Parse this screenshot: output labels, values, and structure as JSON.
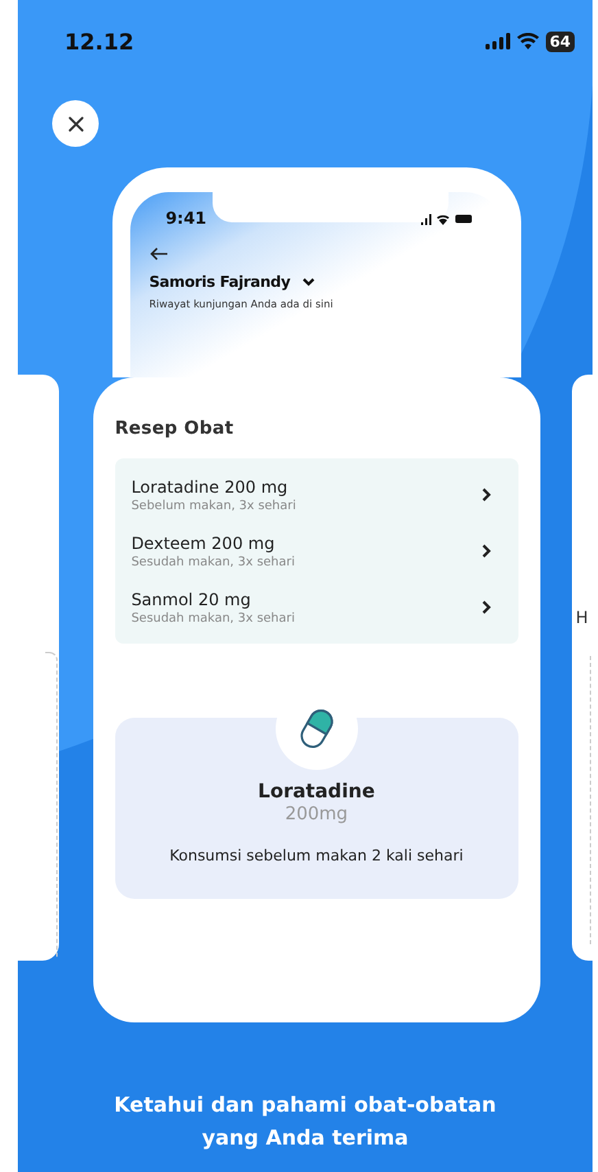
{
  "status_bar": {
    "time": "12.12",
    "battery": "64"
  },
  "mockup": {
    "status_bar": {
      "time": "9:41"
    },
    "user_name": "Samoris Fajrandy",
    "subtitle": "Riwayat kunjungan Anda ada di sini",
    "section_title": "Resep Obat",
    "prescriptions": [
      {
        "name": "Loratadine 200 mg",
        "schedule": "Sebelum makan, 3x sehari"
      },
      {
        "name": "Dexteem 200 mg",
        "schedule": "Sesudah makan, 3x sehari"
      },
      {
        "name": "Sanmol 20 mg",
        "schedule": "Sesudah makan, 3x sehari"
      }
    ],
    "detail": {
      "name": "Loratadine",
      "dose": "200mg",
      "instruction": "Konsumsi sebelum makan 2 kali sehari"
    }
  },
  "next_card": {
    "text": "H"
  },
  "caption": "Ketahui dan pahami obat-obatan yang Anda terima"
}
